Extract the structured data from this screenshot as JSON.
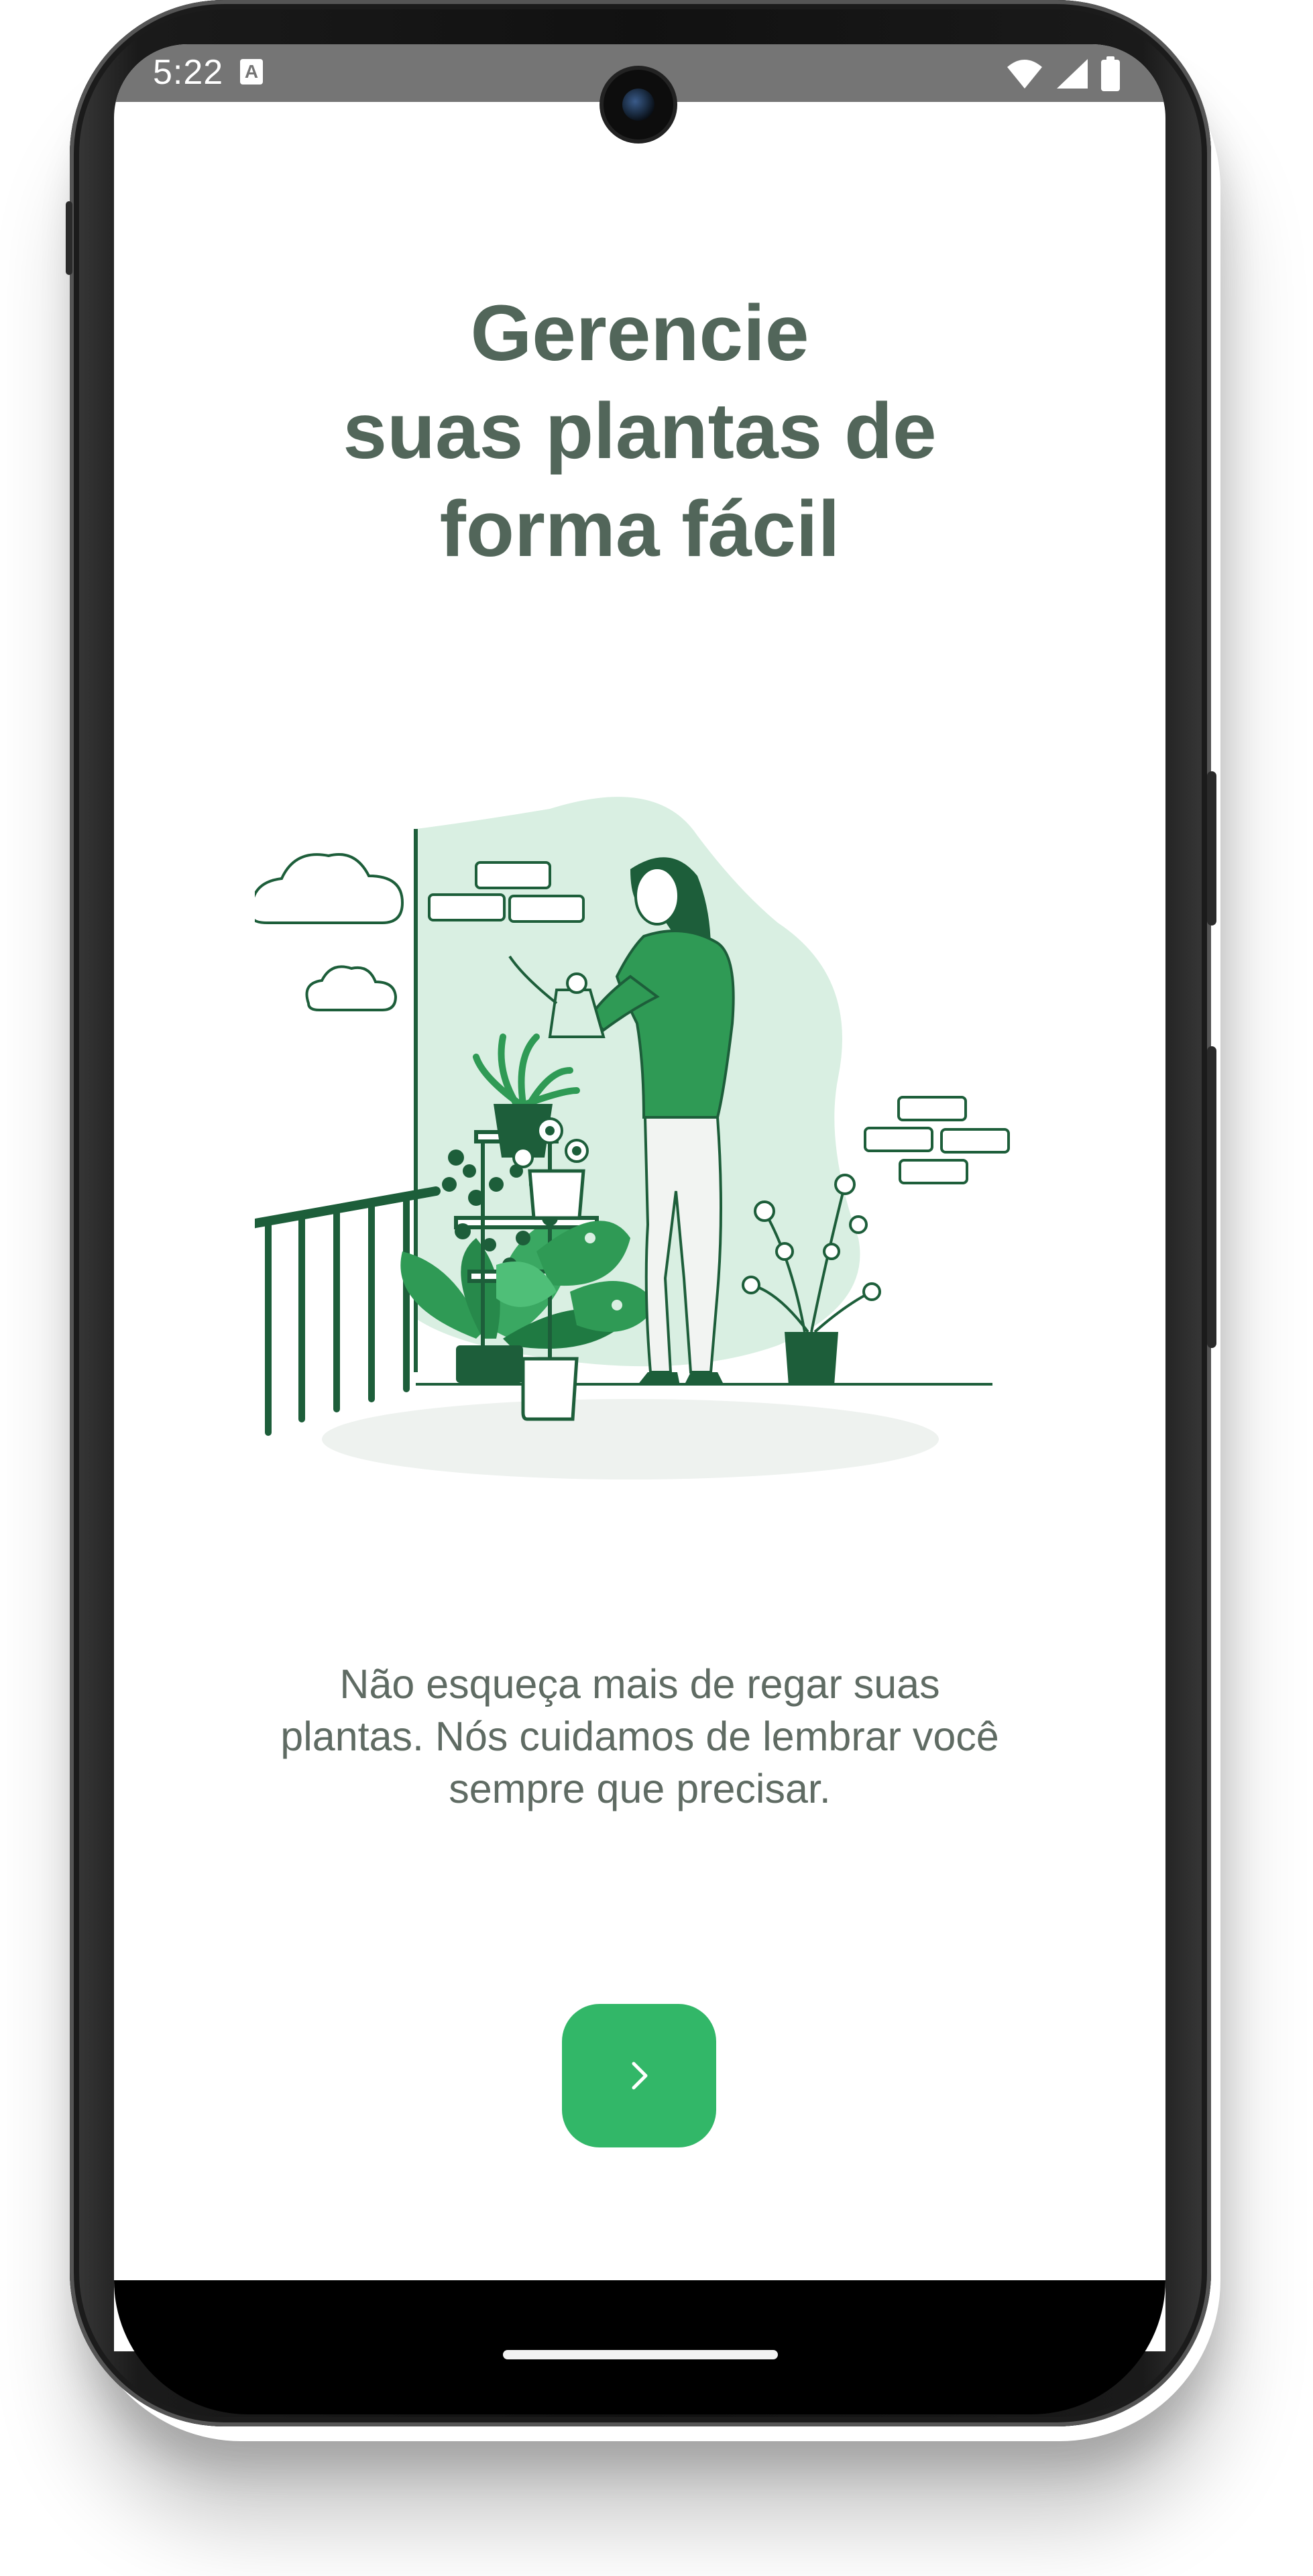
{
  "status_bar": {
    "time": "5:22",
    "notification_icon_letter": "A",
    "icons": [
      "wifi-icon",
      "cellular-signal-icon",
      "battery-icon"
    ]
  },
  "onboarding": {
    "title_lines": [
      "Gerencie",
      "suas plantas de",
      "forma fácil"
    ],
    "description_lines": [
      "Não esqueça mais de regar suas",
      "plantas. Nós cuidamos de lembrar você",
      "sempre que precisar."
    ],
    "next_button_icon": "chevron-right-icon"
  },
  "illustration": {
    "subject": "woman-watering-plants-on-balcony"
  },
  "colors": {
    "title": "#52665a",
    "body_text": "#5f6b63",
    "accent": "#32b768",
    "illustration_dark": "#1d5e3a",
    "illustration_light": "#d9efe2",
    "status_bar": "#757575"
  }
}
